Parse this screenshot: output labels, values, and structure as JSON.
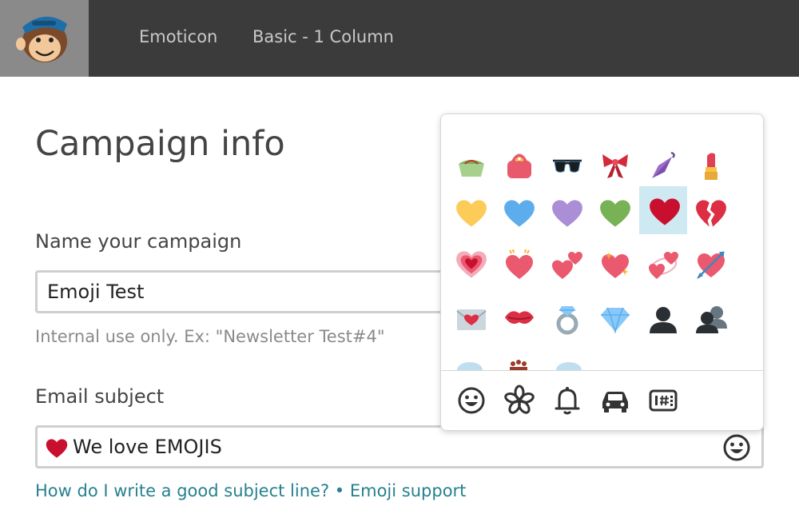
{
  "topbar": {
    "nav": [
      "Emoticon",
      "Basic - 1 Column"
    ]
  },
  "page": {
    "title": "Campaign info",
    "name_label": "Name your campaign",
    "name_value": "Emoji Test",
    "name_help": "Internal use only. Ex: \"Newsletter Test#4\"",
    "subject_label": "Email subject",
    "subject_value": "We love EMOJIS",
    "help_link": "How do I write a good subject line?",
    "separator": " • ",
    "emoji_support_link": "Emoji support"
  },
  "picker": {
    "selected": "red-heart",
    "rows": [
      [
        "clutch-bag",
        "purse",
        "sunglasses",
        "ribbon",
        "closed-umbrella",
        "lipstick"
      ],
      [
        "yellow-heart",
        "blue-heart",
        "purple-heart",
        "green-heart",
        "red-heart",
        "broken-heart"
      ],
      [
        "growing-heart",
        "beating-heart",
        "two-hearts",
        "sparkling-heart",
        "revolving-hearts",
        "heart-with-arrow"
      ],
      [
        "love-letter",
        "kiss-mark",
        "ring",
        "gem-stone",
        "bust-in-silhouette",
        "busts-in-silhouette"
      ]
    ],
    "categories": [
      "smiley-icon",
      "flower-icon",
      "bell-icon",
      "car-icon",
      "symbols-icon"
    ]
  },
  "colors": {
    "topbar": "#3b3b3b",
    "link": "#27808f",
    "selected_cell": "#cfe9f3",
    "heart_red": "#c8102e"
  }
}
